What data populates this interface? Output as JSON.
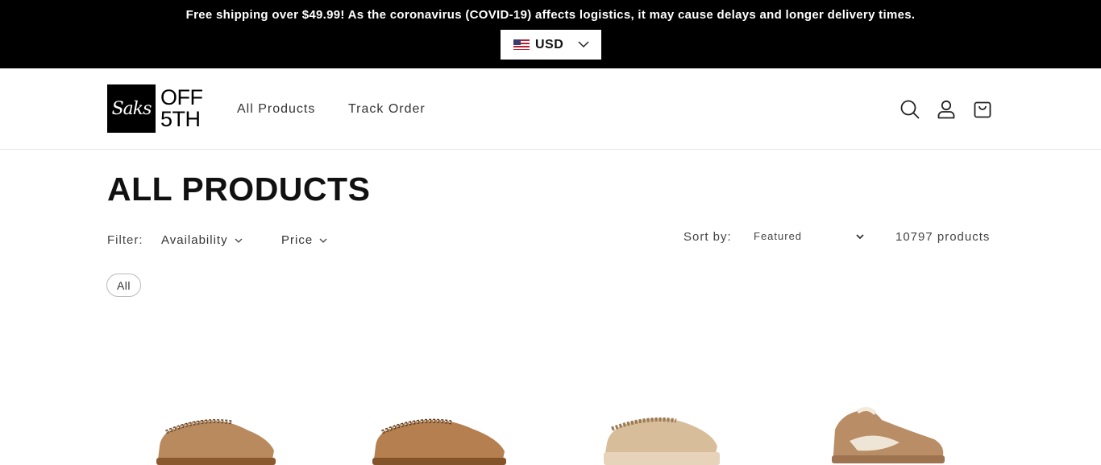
{
  "announcement": {
    "text": "Free shipping over $49.99! As the coronavirus (COVID-19) affects logistics, it may cause delays and longer delivery times.",
    "currency": "USD"
  },
  "header": {
    "logo_mark": "Saks",
    "logo_line1": "OFF",
    "logo_line2": "5TH",
    "nav": [
      "All Products",
      "Track Order"
    ],
    "icons": [
      "search-icon",
      "account-icon",
      "cart-icon"
    ]
  },
  "collection": {
    "title": "ALL PRODUCTS",
    "filter_label": "Filter:",
    "filters": [
      "Availability",
      "Price"
    ],
    "sort_label": "Sort by:",
    "sort_value": "Featured",
    "product_count": "10797 products",
    "active_pill": "All"
  },
  "products": [
    {
      "color": "#b98a5e",
      "style": "slipper"
    },
    {
      "color": "#b57f4f",
      "style": "slipper"
    },
    {
      "color": "#d8bd9a",
      "style": "platform-slipper"
    },
    {
      "color": "#b98d66",
      "style": "sneaker"
    }
  ],
  "colors": {
    "announcement_bg": "#000000",
    "text_primary": "#111111"
  }
}
